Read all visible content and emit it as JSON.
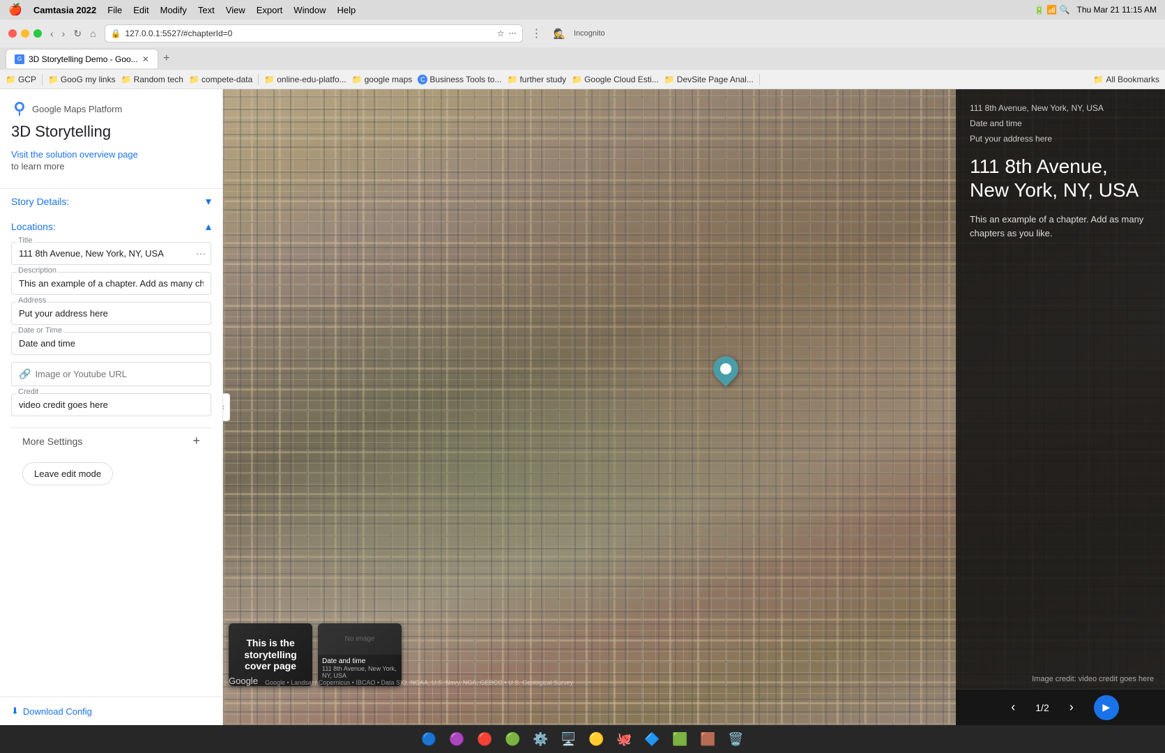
{
  "os": {
    "menu_items": [
      "🍎",
      "Camtasia 2022",
      "File",
      "Edit",
      "Modify",
      "Text",
      "View",
      "Export",
      "Window",
      "Help"
    ],
    "time": "Thu Mar 21  11:15 AM"
  },
  "browser": {
    "tab_title": "3D Storytelling Demo - Goo...",
    "url": "127.0.0.1:5527/#chapterId=0",
    "new_tab_label": "+"
  },
  "bookmarks": [
    {
      "label": "GCP",
      "icon": "📁"
    },
    {
      "label": "GooG my links",
      "icon": "📁"
    },
    {
      "label": "Random tech",
      "icon": "📁"
    },
    {
      "label": "compete-data",
      "icon": "📁"
    },
    {
      "label": "online-edu-platfo...",
      "icon": "📁"
    },
    {
      "label": "google maps",
      "icon": "📁"
    },
    {
      "label": "Business Tools to...",
      "icon": "🔵"
    },
    {
      "label": "further study",
      "icon": "📁"
    },
    {
      "label": "Google Cloud Esti...",
      "icon": "📁"
    },
    {
      "label": "DevSite Page Anal...",
      "icon": "📁"
    },
    {
      "label": "All Bookmarks",
      "icon": "📁"
    }
  ],
  "sidebar": {
    "logo_text": "Google Maps Platform",
    "app_title": "3D Storytelling",
    "solution_link": "Visit the solution overview page",
    "to_learn_more": "to learn more",
    "story_details_label": "Story Details:",
    "locations_label": "Locations:",
    "form": {
      "title_label": "Title",
      "title_value": "111 8th Avenue, New York, NY, USA",
      "description_label": "Description",
      "description_value": "This an example of a chapter. Add as many chapte",
      "address_label": "Address",
      "address_value": "Put your address here",
      "date_time_label": "Date or Time",
      "date_time_value": "Date and time",
      "url_label": "Image or Youtube URL",
      "url_placeholder": "Image or Youtube URL",
      "credit_label": "Credit",
      "credit_value": "video credit goes here"
    },
    "more_settings_label": "More Settings",
    "leave_edit_label": "Leave edit mode",
    "download_config_label": "Download Config"
  },
  "map": {
    "panel": {
      "location": "111 8th Avenue, New York, NY, USA",
      "date": "Date and time",
      "address": "Put your address here",
      "title": "111 8th Avenue, New York, NY, USA",
      "description": "This an example of a chapter. Add as many chapters as you like.",
      "image_credit": "Image credit: video credit goes here"
    },
    "nav": {
      "counter": "1/2",
      "prev_label": "‹",
      "next_label": "›",
      "play_label": "▶"
    }
  },
  "thumbnails": [
    {
      "type": "cover",
      "text": "This is the storytelling cover page"
    },
    {
      "type": "map",
      "date": "Date and time",
      "title": "111 8th Avenue, New York, NY, USA",
      "no_image": "No image"
    }
  ],
  "google_watermark": "Google",
  "map_credits": "Google • Landsat / Copernicus • IBCAO • Data SIO, NOAA, U.S. Navy, NGA, GEBCO • U.S. Geological Survey",
  "dock": {
    "items": [
      "🔵",
      "🟣",
      "🔴",
      "🟢",
      "🔵",
      "🟤",
      "🔵",
      "🟢",
      "🟦",
      "🟩",
      "🟫",
      "⬛",
      "🗑️"
    ]
  }
}
